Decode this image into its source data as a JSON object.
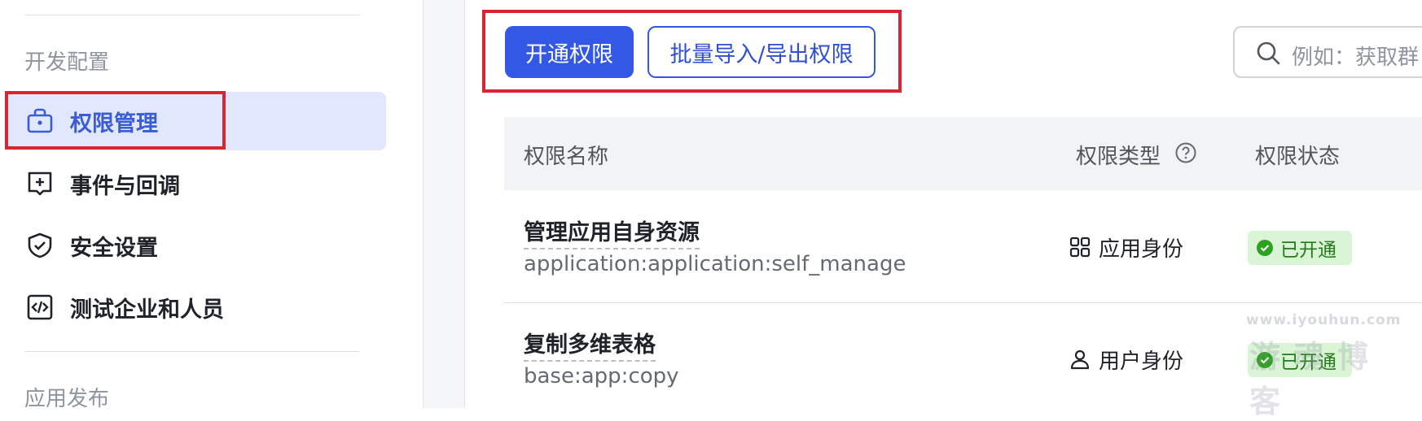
{
  "sidebar": {
    "section_dev": "开发配置",
    "items": [
      {
        "label": "权限管理",
        "icon": "lock-bag-icon",
        "active": true
      },
      {
        "label": "事件与回调",
        "icon": "event-plus-icon",
        "active": false
      },
      {
        "label": "安全设置",
        "icon": "shield-check-icon",
        "active": false
      },
      {
        "label": "测试企业和人员",
        "icon": "code-box-icon",
        "active": false
      }
    ],
    "section_publish": "应用发布"
  },
  "toolbar": {
    "primary_label": "开通权限",
    "batch_label": "批量导入/导出权限"
  },
  "search": {
    "placeholder": "例如：获取群"
  },
  "table": {
    "headers": {
      "name": "权限名称",
      "type": "权限类型",
      "status": "权限状态"
    },
    "rows": [
      {
        "name": "管理应用自身资源",
        "code": "application:application:self_manage",
        "type": "应用身份",
        "type_icon": "grid-apps-icon",
        "status": "已开通"
      },
      {
        "name": "复制多维表格",
        "code": "base:app:copy",
        "type": "用户身份",
        "type_icon": "user-icon",
        "status": "已开通"
      }
    ]
  },
  "watermark": {
    "url": "www.iyouhun.com",
    "name": "游魂博客"
  },
  "colors": {
    "accent": "#3358e6",
    "active_bg": "#e1e8fd",
    "badge_bg": "#d9f5d6",
    "badge_text": "#237b19",
    "highlight_border": "#d92533"
  }
}
